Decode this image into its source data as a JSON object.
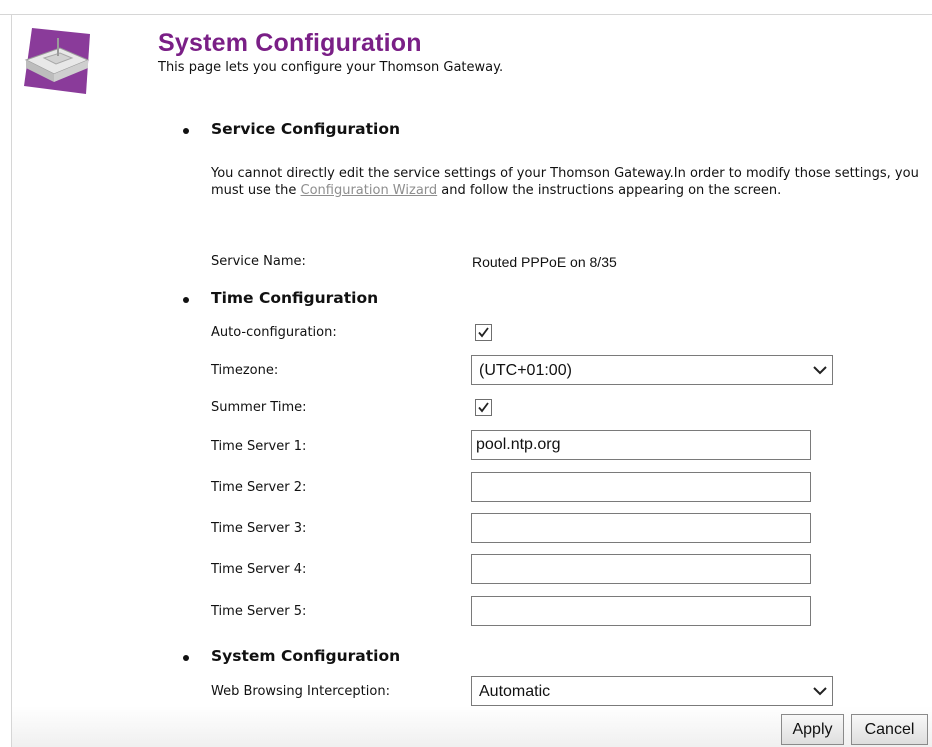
{
  "header": {
    "title": "System Configuration",
    "description": "This page lets you configure your Thomson Gateway."
  },
  "service_section": {
    "heading": "Service Configuration",
    "para_before": "You cannot directly edit the service settings of your Thomson Gateway.In order to modify those settings, you must use the ",
    "link_text": "Configuration Wizard",
    "para_after": " and follow the instructions appearing on the screen.",
    "service_name_label": "Service Name:",
    "service_name_value": "Routed PPPoE on 8/35"
  },
  "time_section": {
    "heading": "Time Configuration",
    "auto_config_label": "Auto-configuration:",
    "auto_config_checked": true,
    "timezone_label": "Timezone:",
    "timezone_value": "(UTC+01:00)",
    "summer_time_label": "Summer Time:",
    "summer_time_checked": true,
    "servers": [
      {
        "label": "Time Server 1:",
        "value": "pool.ntp.org"
      },
      {
        "label": "Time Server 2:",
        "value": ""
      },
      {
        "label": "Time Server 3:",
        "value": ""
      },
      {
        "label": "Time Server 4:",
        "value": ""
      },
      {
        "label": "Time Server 5:",
        "value": ""
      }
    ]
  },
  "system_section": {
    "heading": "System Configuration",
    "web_interception_label": "Web Browsing Interception:",
    "web_interception_value": "Automatic"
  },
  "footer": {
    "apply_label": "Apply",
    "cancel_label": "Cancel"
  },
  "colors": {
    "title": "#7a1f86",
    "link": "#8e8e8e",
    "logo_purple": "#8a3b9a"
  },
  "icons": {
    "logo": "gateway-device-icon",
    "checkbox_mark": "checkmark-icon",
    "dropdown": "chevron-down-icon"
  }
}
